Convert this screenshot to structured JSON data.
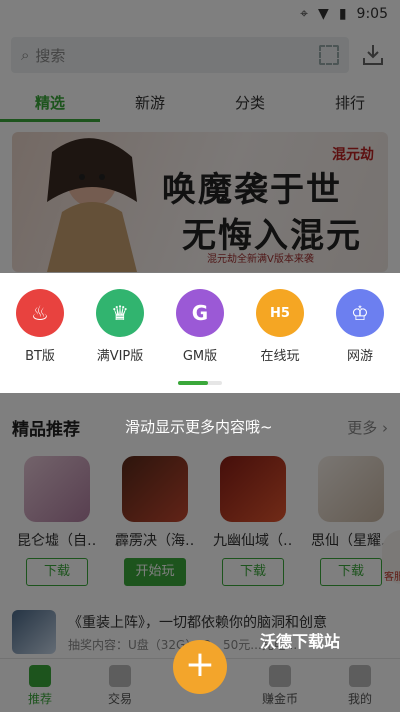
{
  "status": {
    "time": "9:05"
  },
  "search": {
    "placeholder": "搜索"
  },
  "tabs": [
    {
      "label": "精选",
      "active": true
    },
    {
      "label": "新游"
    },
    {
      "label": "分类"
    },
    {
      "label": "排行"
    }
  ],
  "banner": {
    "title_line1": "唤魔袭于世",
    "title_line2": "无悔入混元",
    "subtitle": "混元劫全新满V版本来袭",
    "logo": "混元劫"
  },
  "categories": [
    {
      "label": "BT版",
      "color": "#e8423f",
      "icon": "flame-icon"
    },
    {
      "label": "满VIP版",
      "color": "#31b46f",
      "icon": "crown-icon"
    },
    {
      "label": "GM版",
      "color": "#9b59d6",
      "icon": "g-icon"
    },
    {
      "label": "在线玩",
      "color": "#f5a623",
      "icon": "h5-icon"
    },
    {
      "label": "网游",
      "color": "#6c7ff0",
      "icon": "star-crown-icon"
    }
  ],
  "section": {
    "title": "精品推荐",
    "hint": "滑动显示更多内容哦~",
    "more": "更多"
  },
  "games": [
    {
      "name": "昆仑墟（自…",
      "button": "下载",
      "color": "#c796b8"
    },
    {
      "name": "霹雳决（海…",
      "button": "开始玩",
      "color": "#8a3a2a"
    },
    {
      "name": "九幽仙域（…",
      "button": "下载",
      "color": "#d44a2a"
    },
    {
      "name": "思仙（星耀…",
      "button": "下载",
      "color": "#e7e1da"
    }
  ],
  "news": {
    "title": "《重装上阵》，一切都依赖你的脑洞和创意",
    "subtitle": "抽奖内容：U盘（32G）*3、50元...充电..."
  },
  "watermark": "沃德下载站",
  "float_ad": "客服",
  "nav": [
    {
      "label": "推荐",
      "active": true
    },
    {
      "label": "交易"
    },
    {
      "label": ""
    },
    {
      "label": "赚金币"
    },
    {
      "label": "我的"
    }
  ]
}
